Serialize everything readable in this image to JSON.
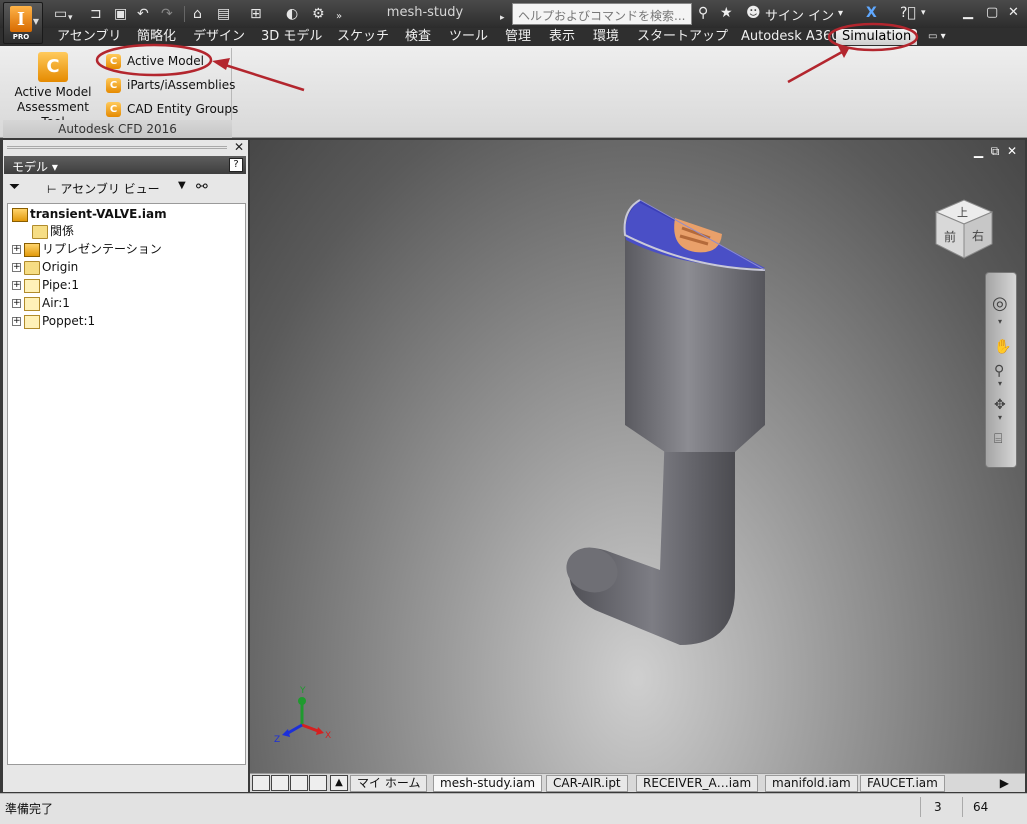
{
  "window": {
    "document_title": "mesh-study",
    "search_placeholder": "ヘルプおよびコマンドを検索...",
    "signin_label": "サイン イン",
    "app_badge": "PRO"
  },
  "ribbon_tabs": [
    {
      "label": "アセンブリ"
    },
    {
      "label": "簡略化"
    },
    {
      "label": "デザイン"
    },
    {
      "label": "3D モデル"
    },
    {
      "label": "スケッチ"
    },
    {
      "label": "検査"
    },
    {
      "label": "ツール"
    },
    {
      "label": "管理"
    },
    {
      "label": "表示"
    },
    {
      "label": "環境"
    },
    {
      "label": "スタートアップ"
    },
    {
      "label": "Autodesk A360"
    },
    {
      "label": "Simulation"
    }
  ],
  "ribbon": {
    "big_button_line1": "Active Model",
    "big_button_line2": "Assessment Tool",
    "small_buttons": [
      {
        "label": "Active Model"
      },
      {
        "label": "iParts/iAssemblies"
      },
      {
        "label": "CAD Entity Groups"
      }
    ],
    "group_label": "Autodesk CFD 2016"
  },
  "browser": {
    "title": "モデル",
    "view_select": "アセンブリ ビュー",
    "tree": [
      {
        "label": "transient-VALVE.iam"
      },
      {
        "label": "関係"
      },
      {
        "label": "リプレゼンテーション"
      },
      {
        "label": "Origin"
      },
      {
        "label": "Pipe:1"
      },
      {
        "label": "Air:1"
      },
      {
        "label": "Poppet:1"
      }
    ]
  },
  "viewport": {
    "viewcube_top": "上",
    "viewcube_front": "前",
    "viewcube_right": "右",
    "axis_x": "X",
    "axis_y": "Y",
    "axis_z": "Z"
  },
  "doc_tabs": [
    {
      "label": "マイ ホーム"
    },
    {
      "label": "mesh-study.iam"
    },
    {
      "label": "CAR-AIR.ipt"
    },
    {
      "label": "RECEIVER_A…iam"
    },
    {
      "label": "manifold.iam"
    },
    {
      "label": "FAUCET.iam"
    }
  ],
  "status": {
    "text": "準備完了",
    "count_a": "3",
    "count_b": "64"
  },
  "colors": {
    "highlight_ring": "#b3262e",
    "model_gray": "#7a7a7f",
    "water_blue": "#4a4fc6",
    "poppet_orange": "#e9a06a"
  }
}
